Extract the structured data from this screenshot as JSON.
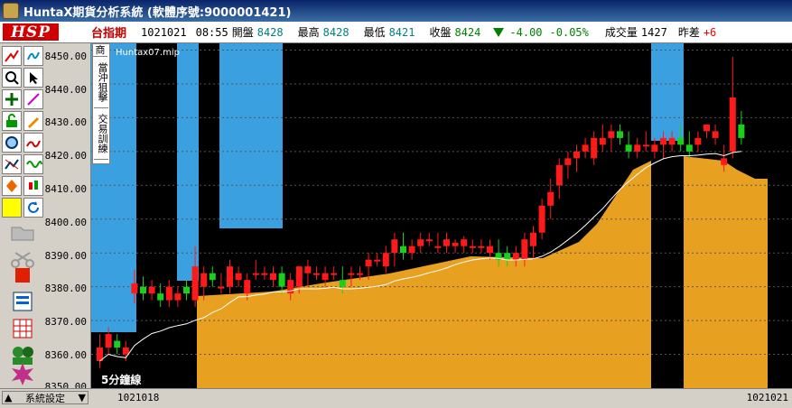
{
  "window": {
    "title": "HuntaX期貨分析系統 (軟體序號:9000001421)"
  },
  "quote": {
    "logo": "HSP",
    "symbol": "台指期",
    "date": "1021021",
    "time": "08:55",
    "open_label": "開盤",
    "open": "8428",
    "high_label": "最高",
    "high": "8428",
    "low_label": "最低",
    "low": "8421",
    "close_label": "收盤",
    "close": "8424",
    "change": "-4.00",
    "change_pct": "-0.05%",
    "volume_label": "成交量",
    "volume": "1427",
    "prev_diff_label": "昨差",
    "prev_diff": "+6"
  },
  "side_panel": {
    "btn1": "商",
    "btn2": "當沖狙擊",
    "btn3": "交易訓練"
  },
  "chart_label": "Huntax07.mip",
  "period_label": "5分鐘線",
  "bottom": {
    "system_settings": "系統設定",
    "date_start": "1021018",
    "date_end": "1021021"
  },
  "chart_data": {
    "type": "candlestick",
    "yticks": [
      "8450.00",
      "8440.00",
      "8430.00",
      "8420.00",
      "8410.00",
      "8400.00",
      "8390.00",
      "8380.00",
      "8370.00",
      "8360.00",
      "8350.00"
    ],
    "ylim": [
      8350,
      8452
    ],
    "candles": [
      [
        8358,
        8366,
        8356,
        8362
      ],
      [
        8362,
        8368,
        8360,
        8366
      ],
      [
        8364,
        8366,
        8360,
        8362
      ],
      [
        8360,
        8364,
        8358,
        8362
      ],
      [
        8378,
        8385,
        8375,
        8381
      ],
      [
        8380,
        8383,
        8376,
        8378
      ],
      [
        8378,
        8382,
        8376,
        8380
      ],
      [
        8378,
        8381,
        8374,
        8376
      ],
      [
        8376,
        8382,
        8374,
        8380
      ],
      [
        8376,
        8380,
        8374,
        8378
      ],
      [
        8380,
        8382,
        8376,
        8378
      ],
      [
        8376,
        8392,
        8374,
        8386
      ],
      [
        8380,
        8386,
        8376,
        8384
      ],
      [
        8384,
        8386,
        8380,
        8382
      ],
      [
        8380,
        8384,
        8378,
        8380
      ],
      [
        8380,
        8388,
        8378,
        8386
      ],
      [
        8382,
        8386,
        8380,
        8384
      ],
      [
        8378,
        8384,
        8376,
        8382
      ],
      [
        8384,
        8388,
        8382,
        8384
      ],
      [
        8384,
        8386,
        8382,
        8384
      ],
      [
        8382,
        8386,
        8380,
        8384
      ],
      [
        8384,
        8386,
        8378,
        8380
      ],
      [
        8378,
        8384,
        8376,
        8382
      ],
      [
        8380,
        8386,
        8378,
        8386
      ],
      [
        8384,
        8388,
        8380,
        8386
      ],
      [
        8384,
        8386,
        8382,
        8384
      ],
      [
        8382,
        8386,
        8380,
        8384
      ],
      [
        8384,
        8386,
        8382,
        8384
      ],
      [
        8382,
        8386,
        8378,
        8380
      ],
      [
        8384,
        8386,
        8380,
        8384
      ],
      [
        8384,
        8386,
        8382,
        8384
      ],
      [
        8386,
        8390,
        8382,
        8388
      ],
      [
        8388,
        8390,
        8386,
        8388
      ],
      [
        8386,
        8392,
        8384,
        8390
      ],
      [
        8390,
        8396,
        8386,
        8394
      ],
      [
        8392,
        8396,
        8388,
        8390
      ],
      [
        8390,
        8394,
        8388,
        8392
      ],
      [
        8392,
        8396,
        8390,
        8394
      ],
      [
        8394,
        8396,
        8392,
        8394
      ],
      [
        8392,
        8396,
        8390,
        8392
      ],
      [
        8392,
        8396,
        8390,
        8394
      ],
      [
        8392,
        8394,
        8390,
        8393
      ],
      [
        8392,
        8395,
        8390,
        8394
      ],
      [
        8392,
        8394,
        8390,
        8392
      ],
      [
        8392,
        8394,
        8390,
        8392
      ],
      [
        8390,
        8394,
        8388,
        8392
      ],
      [
        8390,
        8394,
        8386,
        8388
      ],
      [
        8390,
        8392,
        8386,
        8388
      ],
      [
        8388,
        8392,
        8386,
        8390
      ],
      [
        8388,
        8396,
        8386,
        8394
      ],
      [
        8392,
        8398,
        8388,
        8396
      ],
      [
        8396,
        8406,
        8394,
        8404
      ],
      [
        8404,
        8412,
        8400,
        8408
      ],
      [
        8410,
        8418,
        8406,
        8416
      ],
      [
        8416,
        8420,
        8412,
        8418
      ],
      [
        8418,
        8422,
        8414,
        8420
      ],
      [
        8420,
        8424,
        8418,
        8422
      ],
      [
        8418,
        8426,
        8416,
        8424
      ],
      [
        8422,
        8428,
        8420,
        8424
      ],
      [
        8424,
        8428,
        8420,
        8426
      ],
      [
        8426,
        8428,
        8422,
        8424
      ],
      [
        8422,
        8426,
        8418,
        8420
      ],
      [
        8420,
        8424,
        8418,
        8422
      ],
      [
        8422,
        8426,
        8420,
        8422
      ],
      [
        8420,
        8424,
        8418,
        8422
      ],
      [
        8422,
        8426,
        8418,
        8424
      ],
      [
        8422,
        8426,
        8420,
        8424
      ],
      [
        8424,
        8428,
        8420,
        8422
      ],
      [
        8422,
        8426,
        8418,
        8420
      ],
      [
        8422,
        8426,
        8420,
        8424
      ],
      [
        8426,
        8428,
        8424,
        8428
      ],
      [
        8424,
        8428,
        8422,
        8426
      ]
    ],
    "candles_tail": [
      [
        8416,
        8422,
        8414,
        8418
      ],
      [
        8420,
        8448,
        8418,
        8436
      ],
      [
        8428,
        8432,
        8422,
        8424
      ]
    ]
  }
}
